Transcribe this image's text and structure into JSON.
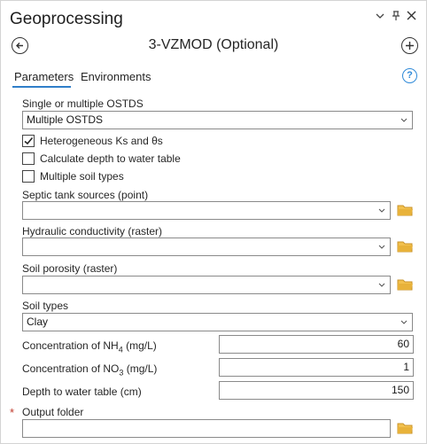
{
  "pane": {
    "title": "Geoprocessing",
    "controls": {
      "dropdown": "⌄",
      "pin": "ᵖ",
      "close": "✕"
    }
  },
  "tool": {
    "title": "3-VZMOD (Optional)",
    "back_icon": "back-arrow-icon",
    "add_icon": "add-icon"
  },
  "tabs": [
    {
      "label": "Parameters",
      "active": true
    },
    {
      "label": "Environments",
      "active": false
    }
  ],
  "help_label": "?",
  "params": {
    "ostds": {
      "label": "Single or multiple OSTDS",
      "value": "Multiple OSTDS"
    },
    "checkboxes": [
      {
        "label": "Heterogeneous Ks and θs",
        "checked": true
      },
      {
        "label": "Calculate depth to water table",
        "checked": false
      },
      {
        "label": "Multiple soil types",
        "checked": false
      }
    ],
    "septic": {
      "label": "Septic tank sources (point)",
      "value": ""
    },
    "hydraulic": {
      "label": "Hydraulic conductivity (raster)",
      "value": ""
    },
    "porosity": {
      "label": "Soil porosity (raster)",
      "value": ""
    },
    "soil_types": {
      "label": "Soil types",
      "value": "Clay"
    },
    "nh4": {
      "label_prefix": "Concentration of NH",
      "label_sub": "4",
      "label_suffix": " (mg/L)",
      "value": "60"
    },
    "no3": {
      "label_prefix": "Concentration of NO",
      "label_sub": "3",
      "label_suffix": " (mg/L)",
      "value": "1"
    },
    "depth": {
      "label": "Depth to water table (cm)",
      "value": "150"
    },
    "output": {
      "required_mark": "*",
      "label": "Output folder",
      "value": ""
    }
  },
  "colors": {
    "accent": "#2f7ec9",
    "folder": "#e8b23a",
    "required": "#c0392b"
  }
}
